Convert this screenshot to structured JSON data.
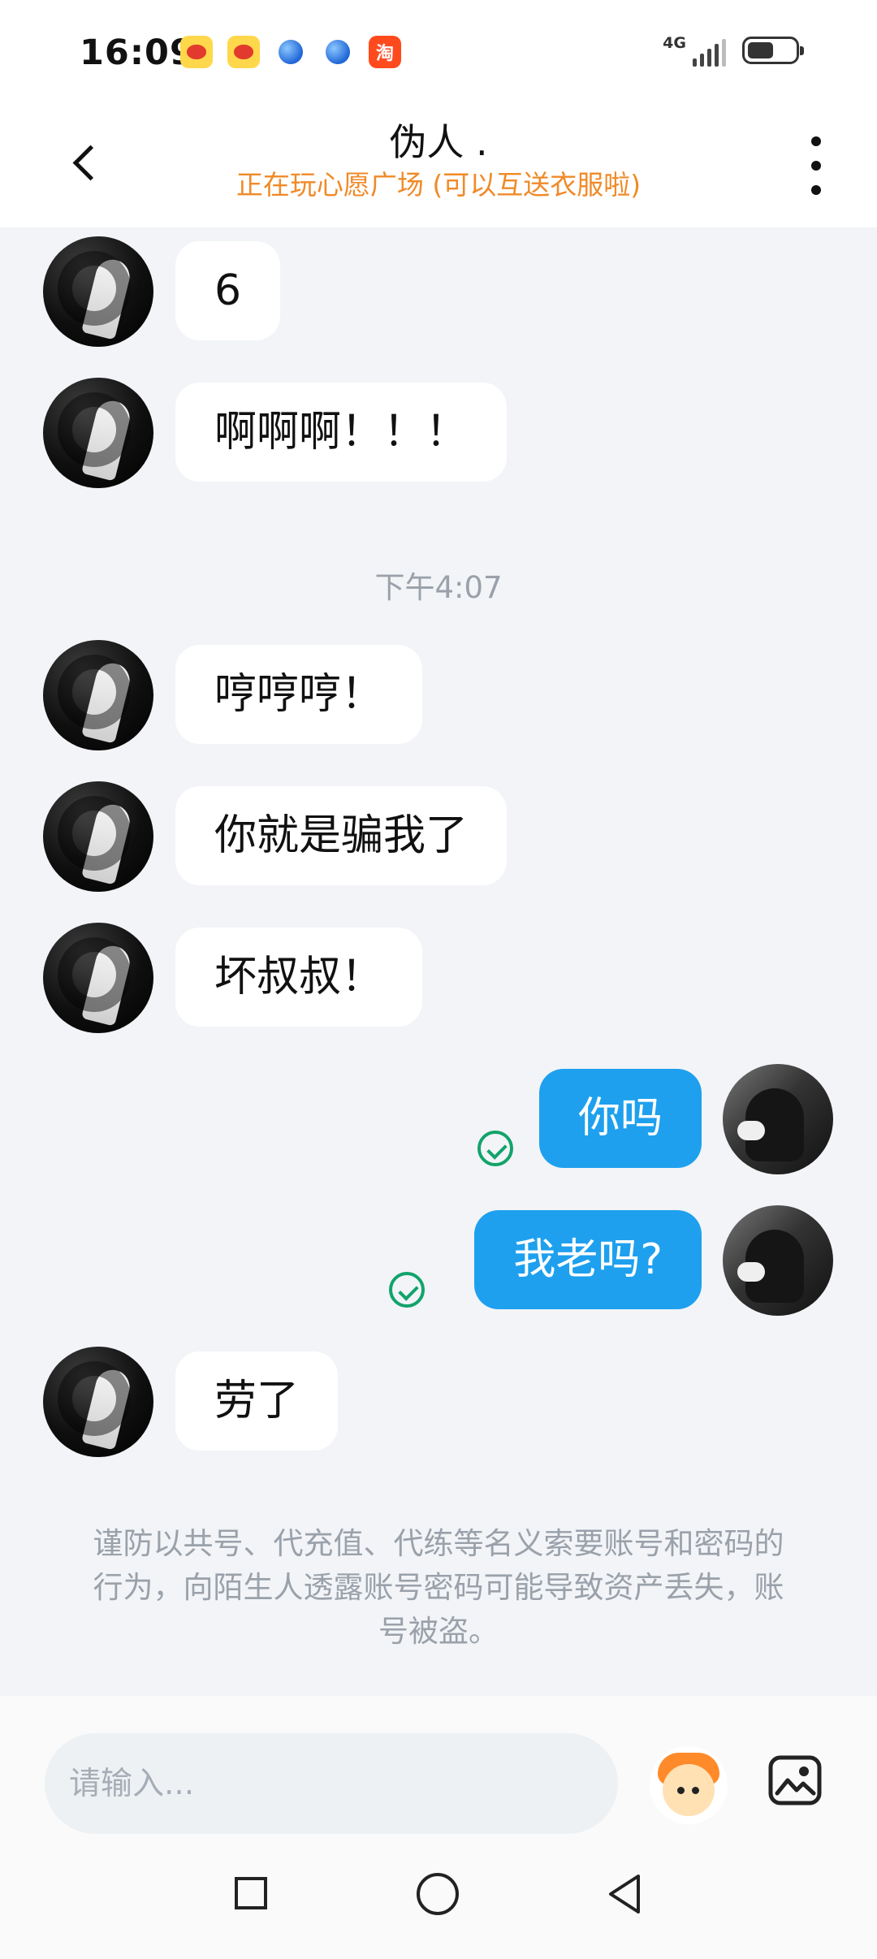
{
  "status_bar": {
    "time": "16:09",
    "network": "4G",
    "taobao_badge": "淘",
    "signal_level": 4,
    "battery_fraction": 0.55
  },
  "header": {
    "title": "伪人 .",
    "subtitle": "正在玩心愿广场 (可以互送衣服啦)"
  },
  "messages": [
    {
      "from": "other",
      "text": "6"
    },
    {
      "from": "other",
      "text": "啊啊啊！！！"
    },
    {
      "type": "timestamp",
      "text": "下午4:07"
    },
    {
      "from": "other",
      "text": "哼哼哼！"
    },
    {
      "from": "other",
      "text": "你就是骗我了"
    },
    {
      "from": "other",
      "text": "坏叔叔！"
    },
    {
      "from": "me",
      "text": "你吗",
      "status": "read"
    },
    {
      "from": "me",
      "text": "我老吗?",
      "status": "read"
    },
    {
      "from": "other",
      "text": "劳了"
    }
  ],
  "warning": {
    "text": "谨防以共号、代充值、代练等名义索要账号和密码的行为，向陌生人透露账号密码可能导致资产丢失，账号被盗。"
  },
  "input": {
    "placeholder": "请输入..."
  },
  "icons": {
    "back": "back-icon",
    "more": "more-vertical-icon",
    "sent_status": "check-circle-icon",
    "emoji": "emoji-icon",
    "image": "image-icon"
  },
  "colors": {
    "accent_blue": "#1ea0ee",
    "subtitle_orange": "#f08a28",
    "status_green": "#12a36b",
    "chat_background": "#f2f4f7"
  }
}
